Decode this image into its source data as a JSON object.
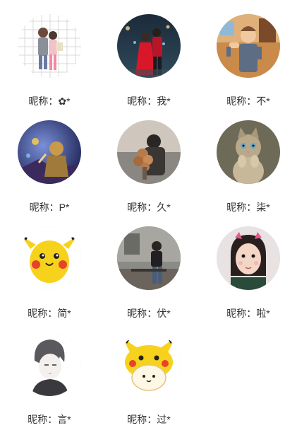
{
  "users": [
    {
      "nickname": "昵称：✿*",
      "avatar_icon": "couple-cartoon-avatar-icon"
    },
    {
      "nickname": "昵称：我*",
      "avatar_icon": "couple-photo-avatar-icon"
    },
    {
      "nickname": "昵称：不*",
      "avatar_icon": "cartoon-man-avatar-icon"
    },
    {
      "nickname": "昵称：P*",
      "avatar_icon": "game-character-avatar-icon"
    },
    {
      "nickname": "昵称：久*",
      "avatar_icon": "bouquet-couple-avatar-icon"
    },
    {
      "nickname": "昵称：柒*",
      "avatar_icon": "kitten-avatar-icon"
    },
    {
      "nickname": "昵称：简*",
      "avatar_icon": "pikachu-avatar-icon"
    },
    {
      "nickname": "昵称：伏*",
      "avatar_icon": "man-sitting-avatar-icon"
    },
    {
      "nickname": "昵称：啦*",
      "avatar_icon": "girl-selfie-avatar-icon"
    },
    {
      "nickname": "昵称：言*",
      "avatar_icon": "anime-boy-avatar-icon"
    },
    {
      "nickname": "昵称：过*",
      "avatar_icon": "pikachu-hat-avatar-icon"
    }
  ]
}
